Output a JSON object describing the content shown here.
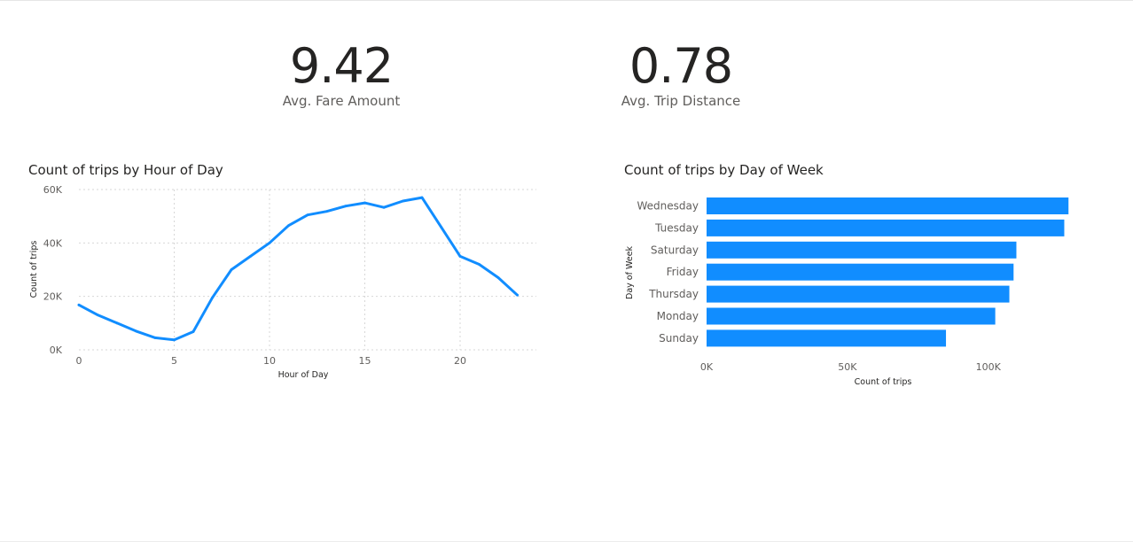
{
  "kpis": {
    "fare": {
      "value": "9.42",
      "label": "Avg. Fare Amount"
    },
    "distance": {
      "value": "0.78",
      "label": "Avg. Trip Distance"
    }
  },
  "colors": {
    "accent": "#118dff",
    "text": "#252423",
    "subtext": "#605e5c"
  },
  "chart_data": [
    {
      "type": "line",
      "title": "Count of trips by Hour of Day",
      "xlabel": "Hour of Day",
      "ylabel": "Count of trips",
      "xlim": [
        0,
        24
      ],
      "ylim": [
        0,
        60000
      ],
      "xticks": [
        0,
        5,
        10,
        15,
        20
      ],
      "xtick_labels": [
        "0",
        "5",
        "10",
        "15",
        "20"
      ],
      "yticks": [
        0,
        20000,
        40000,
        60000
      ],
      "ytick_labels": [
        "0K",
        "20K",
        "40K",
        "60K"
      ],
      "grid": true,
      "series": [
        {
          "x": [
            0,
            1,
            2,
            3,
            4,
            5,
            6,
            7,
            8,
            9,
            10,
            11,
            12,
            13,
            14,
            15,
            16,
            17,
            18,
            19,
            20,
            21,
            22,
            23
          ],
          "values": [
            16800,
            13000,
            10000,
            7000,
            4500,
            3700,
            6800,
            19500,
            30000,
            35000,
            40000,
            46500,
            50500,
            51800,
            53800,
            55000,
            53300,
            55700,
            57000,
            46000,
            35000,
            32000,
            27000,
            20500
          ]
        }
      ]
    },
    {
      "type": "bar",
      "orientation": "horizontal",
      "title": "Count of trips by Day of Week",
      "xlabel": "Count of trips",
      "ylabel": "Day of Week",
      "xlim": [
        0,
        130000
      ],
      "xticks": [
        0,
        50000,
        100000
      ],
      "xtick_labels": [
        "0K",
        "50K",
        "100K"
      ],
      "categories": [
        "Wednesday",
        "Tuesday",
        "Saturday",
        "Friday",
        "Thursday",
        "Monday",
        "Sunday"
      ],
      "values": [
        128500,
        127000,
        110000,
        109000,
        107500,
        102500,
        85000
      ]
    }
  ]
}
